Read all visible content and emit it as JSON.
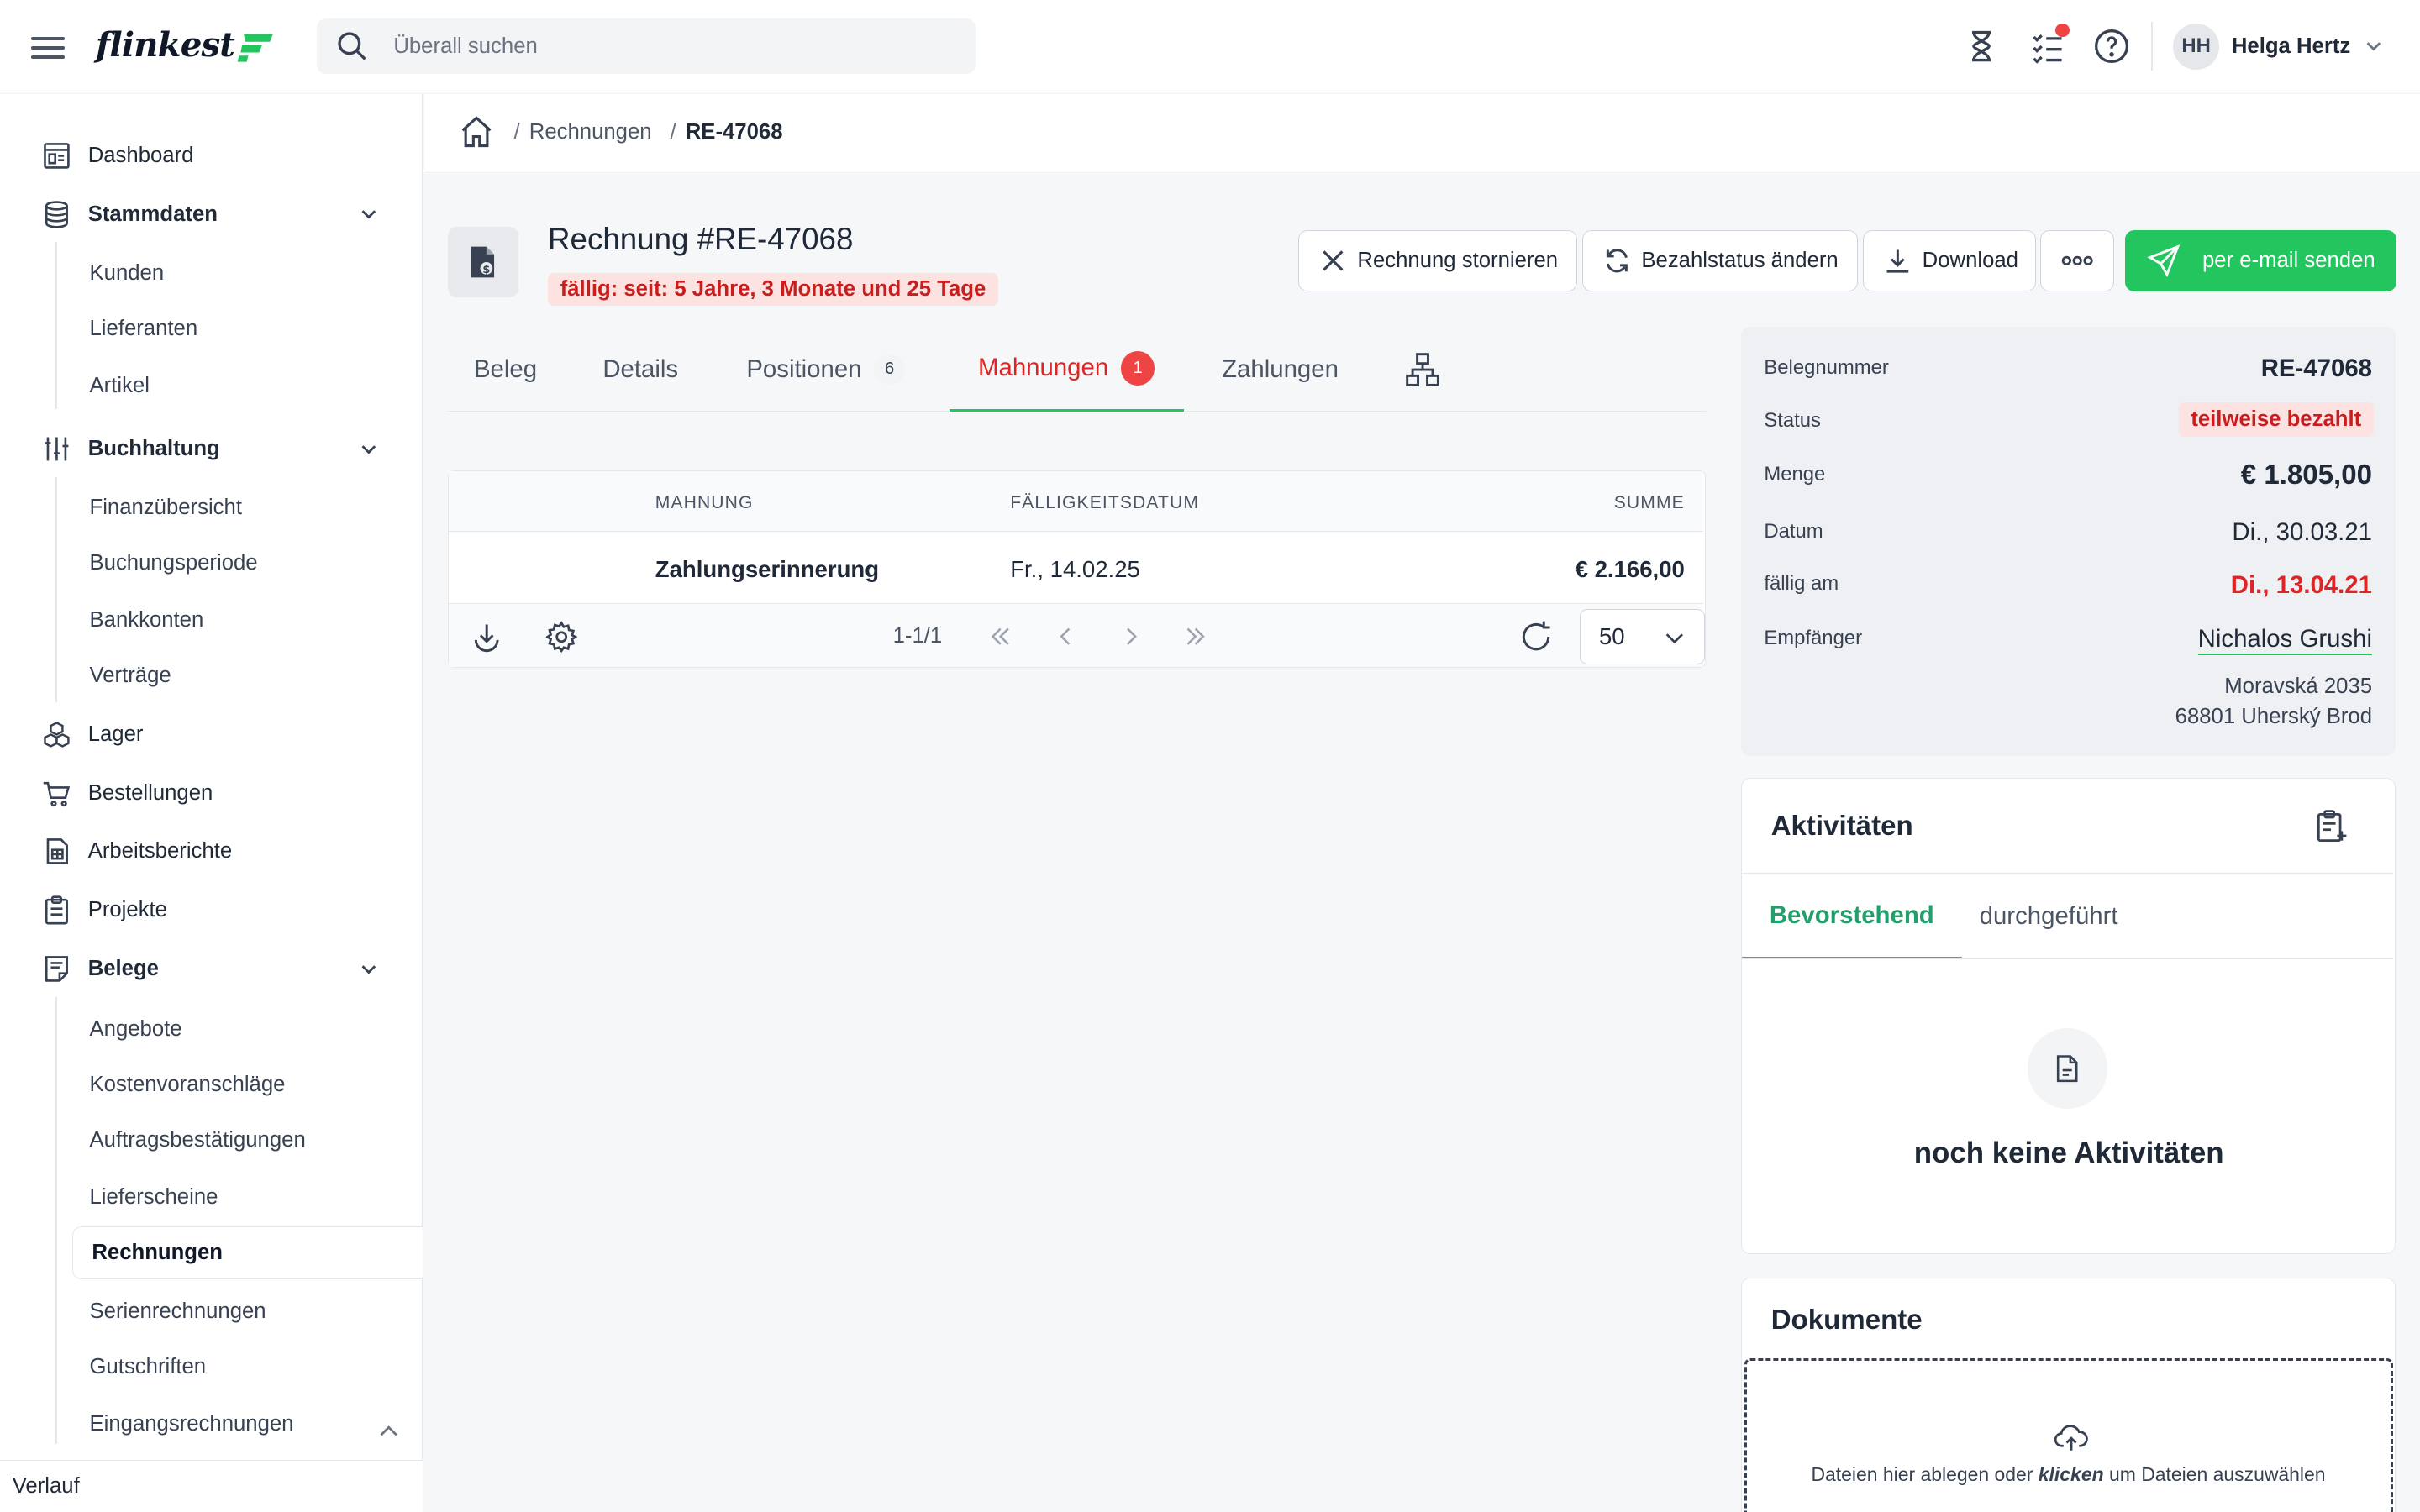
{
  "topbar": {
    "logo_text": "flinkest",
    "search_placeholder": "Überall suchen",
    "user_initials": "HH",
    "user_name": "Helga Hertz"
  },
  "sidebar": {
    "items": [
      {
        "label": "Dashboard",
        "icon": "dashboard-icon"
      },
      {
        "label": "Stammdaten",
        "icon": "database-icon",
        "expanded": true,
        "children": [
          "Kunden",
          "Lieferanten",
          "Artikel"
        ]
      },
      {
        "label": "Buchhaltung",
        "icon": "sliders-icon",
        "expanded": true,
        "children": [
          "Finanzübersicht",
          "Buchungsperiode",
          "Bankkonten",
          "Verträge"
        ]
      },
      {
        "label": "Lager",
        "icon": "boxes-icon"
      },
      {
        "label": "Bestellungen",
        "icon": "cart-icon"
      },
      {
        "label": "Arbeitsberichte",
        "icon": "report-icon"
      },
      {
        "label": "Projekte",
        "icon": "clipboard-icon"
      },
      {
        "label": "Belege",
        "icon": "receipt-icon",
        "expanded": true,
        "children": [
          "Angebote",
          "Kostenvoranschläge",
          "Auftragsbestätigungen",
          "Lieferscheine",
          "Rechnungen",
          "Serienrechnungen",
          "Gutschriften",
          "Eingangsrechnungen"
        ]
      }
    ],
    "active_child": "Rechnungen",
    "footer": "Verlauf"
  },
  "breadcrumb": {
    "items": [
      "Rechnungen",
      "RE-47068"
    ]
  },
  "header": {
    "title": "Rechnung #RE-47068",
    "due_badge": "fällig: seit: 5 Jahre, 3 Monate und 25 Tage",
    "actions": {
      "cancel": "Rechnung stornieren",
      "payment_status": "Bezahlstatus ändern",
      "download": "Download",
      "send_email": "per e-mail senden"
    }
  },
  "tabs": [
    {
      "label": "Beleg"
    },
    {
      "label": "Details"
    },
    {
      "label": "Positionen",
      "count": "6"
    },
    {
      "label": "Mahnungen",
      "count": "1",
      "active": true
    },
    {
      "label": "Zahlungen"
    }
  ],
  "table": {
    "columns": [
      "MAHNUNG",
      "FÄLLIGKEITSDATUM",
      "SUMME"
    ],
    "rows": [
      {
        "mahnung": "Zahlungserinnerung",
        "faelligkeitsdatum": "Fr., 14.02.25",
        "summe": "€ 2.166,00"
      }
    ],
    "page_info": "1-1/1",
    "per_page": "50"
  },
  "info": {
    "belegnummer_label": "Belegnummer",
    "belegnummer": "RE-47068",
    "status_label": "Status",
    "status": "teilweise bezahlt",
    "menge_label": "Menge",
    "menge": "€ 1.805,00",
    "datum_label": "Datum",
    "datum": "Di., 30.03.21",
    "faellig_label": "fällig am",
    "faellig": "Di., 13.04.21",
    "empfaenger_label": "Empfänger",
    "empfaenger": "Nichalos Grushi",
    "address_line1": "Moravská 2035",
    "address_line2": "68801 Uherský Brod"
  },
  "activities": {
    "title": "Aktivitäten",
    "tab_upcoming": "Bevorstehend",
    "tab_done": "durchgeführt",
    "empty": "noch keine Aktivitäten"
  },
  "documents": {
    "title": "Dokumente",
    "drop_text_before": "Dateien hier ablegen oder ",
    "drop_text_link": "klicken",
    "drop_text_after": " um Dateien auszuwählen"
  },
  "colors": {
    "accent_green": "#22c55e",
    "danger_red": "#dc2626",
    "danger_bg": "#fde2e2"
  }
}
